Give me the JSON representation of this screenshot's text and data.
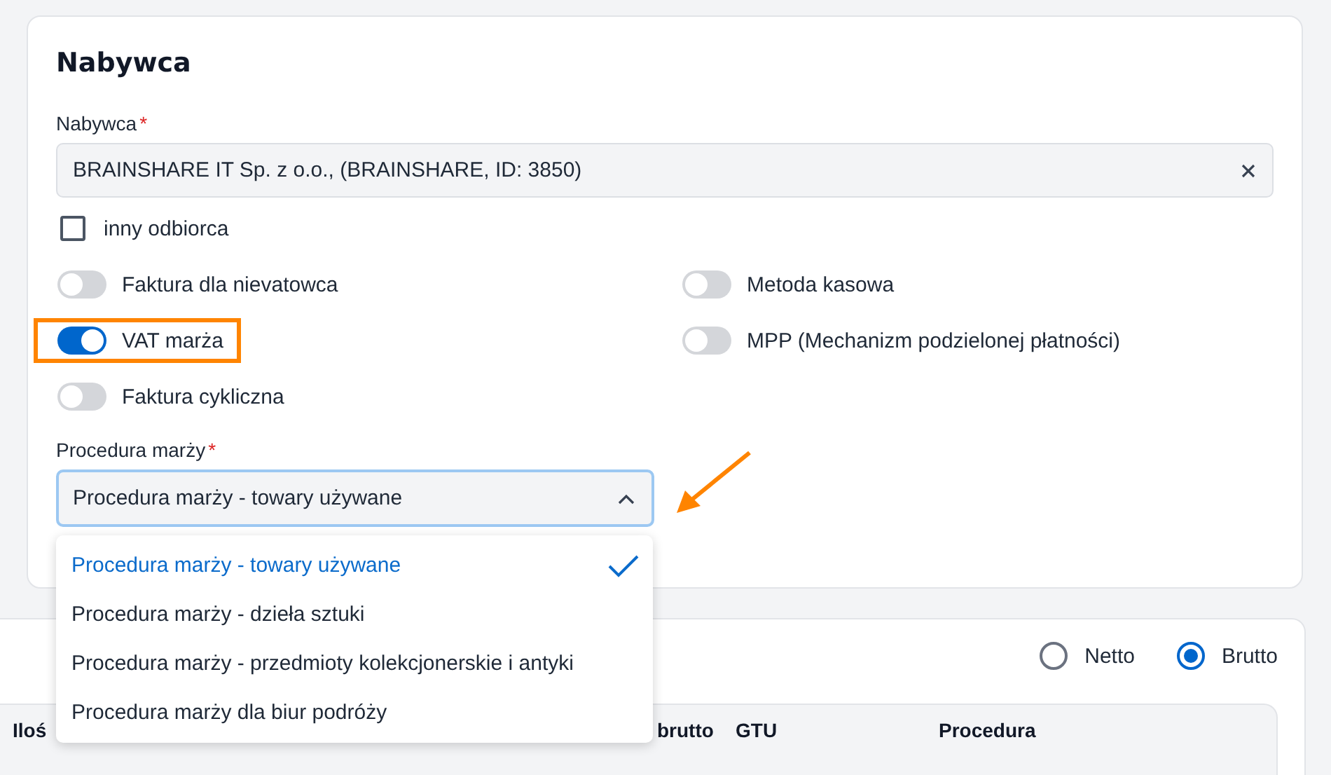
{
  "section": {
    "title": "Nabywca"
  },
  "buyer_field": {
    "label": "Nabywca",
    "required_mark": "*",
    "value": "BRAINSHARE IT Sp. z o.o., (BRAINSHARE, ID: 3850)"
  },
  "other_recipient": {
    "label": "inny odbiorca",
    "checked": false
  },
  "toggles": [
    {
      "label": "Faktura dla nievatowca",
      "on": false,
      "highlighted": false
    },
    {
      "label": "Metoda kasowa",
      "on": false,
      "highlighted": false
    },
    {
      "label": "VAT marża",
      "on": true,
      "highlighted": true
    },
    {
      "label": "MPP (Mechanizm podzielonej płatności)",
      "on": false,
      "highlighted": false
    },
    {
      "label": "Faktura cykliczna",
      "on": false,
      "highlighted": false
    }
  ],
  "procedure": {
    "label": "Procedura marży",
    "required_mark": "*",
    "value": "Procedura marży - towary używane",
    "expanded": true,
    "options": [
      {
        "label": "Procedura marży - towary używane",
        "selected": true
      },
      {
        "label": "Procedura marży - dzieła sztuki",
        "selected": false
      },
      {
        "label": "Procedura marży - przedmioty kolekcjonerskie i antyki",
        "selected": false
      },
      {
        "label": "Procedura marży dla biur podróży",
        "selected": false
      }
    ]
  },
  "price_mode": [
    {
      "label": "Netto",
      "selected": false
    },
    {
      "label": "Brutto",
      "selected": true
    }
  ],
  "table": {
    "columns": [
      "Iloś",
      "brutto",
      "GTU",
      "Procedura"
    ]
  }
}
